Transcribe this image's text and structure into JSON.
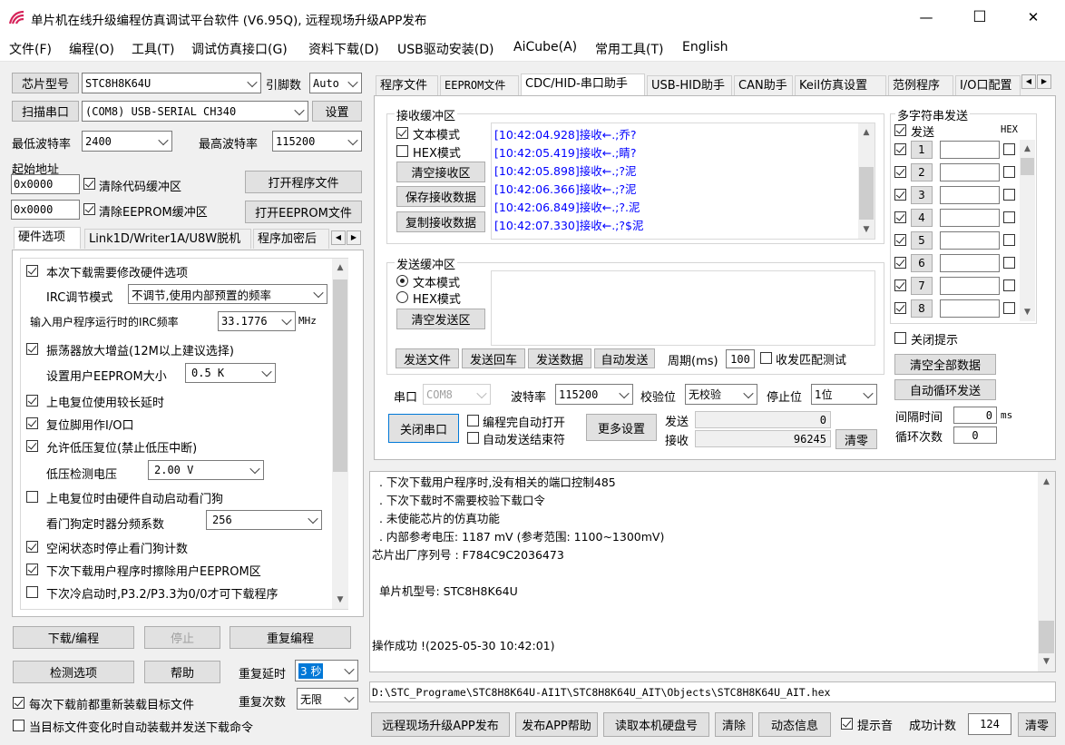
{
  "window": {
    "title": "单片机在线升级编程仿真调试平台软件 (V6.95Q), 远程现场升级APP发布",
    "min_glyph": "—",
    "max_glyph": "☐",
    "close_glyph": "✕"
  },
  "menu": [
    "文件(F)",
    "编程(O)",
    "工具(T)",
    "调试仿真接口(G)",
    "资料下载(D)",
    "USB驱动安装(D)",
    "AiCube(A)",
    "常用工具(T)",
    "English"
  ],
  "left": {
    "chip_model_btn": "芯片型号",
    "chip_model_value": "STC8H8K64U",
    "pin_count_label": "引脚数",
    "pin_count_value": "Auto",
    "scan_port_btn": "扫描串口",
    "port_value": "(COM8) USB-SERIAL CH340",
    "settings_btn": "设置",
    "min_baud_label": "最低波特率",
    "min_baud_value": "2400",
    "max_baud_label": "最高波特率",
    "max_baud_value": "115200",
    "start_addr_label": "起始地址",
    "addr1_value": "0x0000",
    "clear_code_buf_label": "清除代码缓冲区",
    "open_program_btn": "打开程序文件",
    "addr2_value": "0x0000",
    "clear_eeprom_buf_label": "清除EEPROM缓冲区",
    "open_eeprom_btn": "打开EEPROM文件",
    "tabs": [
      "硬件选项",
      "Link1D/Writer1A/U8W脱机",
      "程序加密后"
    ],
    "hw_options": {
      "modify_hw_label": "本次下载需要修改硬件选项",
      "irc_adjust_label": "IRC调节模式",
      "irc_adjust_value": "不调节,使用内部预置的频率",
      "irc_freq_label": "输入用户程序运行时的IRC频率",
      "irc_freq_value": "33.1776",
      "irc_freq_unit": "MHz",
      "osc_gain_label": "振荡器放大增益(12M以上建议选择)",
      "eeprom_size_label": "设置用户EEPROM大小",
      "eeprom_size_value": "0.5 K",
      "long_reset_label": "上电复位使用较长延时",
      "reset_io_label": "复位脚用作I/O口",
      "lvd_reset_label": "允许低压复位(禁止低压中断)",
      "lvd_voltage_label": "低压检测电压",
      "lvd_voltage_value": "2.00 V",
      "wdt_auto_label": "上电复位时由硬件自动启动看门狗",
      "wdt_div_label": "看门狗定时器分频系数",
      "wdt_div_value": "256",
      "wdt_idle_label": "空闲状态时停止看门狗计数",
      "erase_eeprom_label": "下次下载用户程序时擦除用户EEPROM区",
      "cold_start_label": "下次冷启动时,P3.2/P3.3为0/0才可下载程序"
    },
    "download_btn": "下载/编程",
    "stop_btn": "停止",
    "reprogram_btn": "重复编程",
    "detect_btn": "检测选项",
    "help_btn": "帮助",
    "repeat_delay_label": "重复延时",
    "repeat_delay_value": "3 秒",
    "repeat_count_label": "重复次数",
    "repeat_count_value": "无限",
    "reload_label": "每次下载前都重新装载目标文件",
    "auto_load_label": "当目标文件变化时自动装载并发送下载命令"
  },
  "right_tabs": [
    "程序文件",
    "EEPROM文件",
    "CDC/HID-串口助手",
    "USB-HID助手",
    "CAN助手",
    "Keil仿真设置",
    "范例程序",
    "I/O口配置"
  ],
  "serial": {
    "recv_group_title": "接收缓冲区",
    "text_mode_label": "文本模式",
    "hex_mode_label": "HEX模式",
    "clear_recv_btn": "清空接收区",
    "save_recv_btn": "保存接收数据",
    "copy_recv_btn": "复制接收数据",
    "recv_lines": [
      "[10:42:04.928]接收←.;乔?",
      "[10:42:05.419]接收←.;睛?",
      "[10:42:05.898]接收←.;?泥",
      "[10:42:06.366]接收←.;?泥",
      "[10:42:06.849]接收←.;?.泥",
      "[10:42:07.330]接收←.;?$泥"
    ],
    "send_group_title": "发送缓冲区",
    "send_text_mode_label": "文本模式",
    "send_hex_mode_label": "HEX模式",
    "clear_send_btn": "清空发送区",
    "send_file_btn": "发送文件",
    "send_echo_btn": "发送回车",
    "send_data_btn": "发送数据",
    "auto_send_btn": "自动发送",
    "period_label": "周期(ms)",
    "period_value": "100",
    "match_test_label": "收发匹配测试",
    "port_label": "串口",
    "port_value": "COM8",
    "baud_label": "波特率",
    "baud_value": "115200",
    "parity_label": "校验位",
    "parity_value": "无校验",
    "stop_label": "停止位",
    "stop_value": "1位",
    "close_port_btn": "关闭串口",
    "auto_open_label": "编程完自动打开",
    "auto_send_end_label": "自动发送结束符",
    "more_settings_btn": "更多设置",
    "send_count_label": "发送",
    "send_count_value": "0",
    "recv_count_label": "接收",
    "recv_count_value": "96245",
    "clear_count_btn": "清零"
  },
  "multi": {
    "title": "多字符串发送",
    "send_header": "发送",
    "hex_header": "HEX",
    "rows": [
      "1",
      "2",
      "3",
      "4",
      "5",
      "6",
      "7",
      "8"
    ],
    "close_tip_label": "关闭提示",
    "clear_all_btn": "清空全部数据",
    "auto_loop_btn": "自动循环发送",
    "interval_label": "间隔时间",
    "interval_value": "0",
    "interval_unit": "ms",
    "loop_count_label": "循环次数",
    "loop_count_value": "0"
  },
  "log": {
    "lines": [
      "  . 下次下载用户程序时,没有相关的端口控制485",
      "  . 下次下载时不需要校验下载口令",
      "  . 未使能芯片的仿真功能",
      "  . 内部参考电压: 1187 mV (参考范围: 1100~1300mV)",
      "芯片出厂序列号 : F784C9C2036473",
      "",
      "  单片机型号: STC8H8K64U",
      "",
      "",
      "操作成功 !(2025-05-30 10:42:01)"
    ]
  },
  "file_path": "D:\\STC_Programe\\STC8H8K64U-AI1T\\STC8H8K64U_AIT\\Objects\\STC8H8K64U_AIT.hex",
  "bottom": {
    "remote_publish_btn": "远程现场升级APP发布",
    "publish_help_btn": "发布APP帮助",
    "read_disk_btn": "读取本机硬盘号",
    "clear_btn": "清除",
    "dynamic_info_btn": "动态信息",
    "beep_label": "提示音",
    "success_count_label": "成功计数",
    "success_count_value": "124",
    "clear_zero_btn": "清零"
  },
  "colors": {
    "accent": "#0078d7",
    "recv_text": "#0000ff"
  }
}
